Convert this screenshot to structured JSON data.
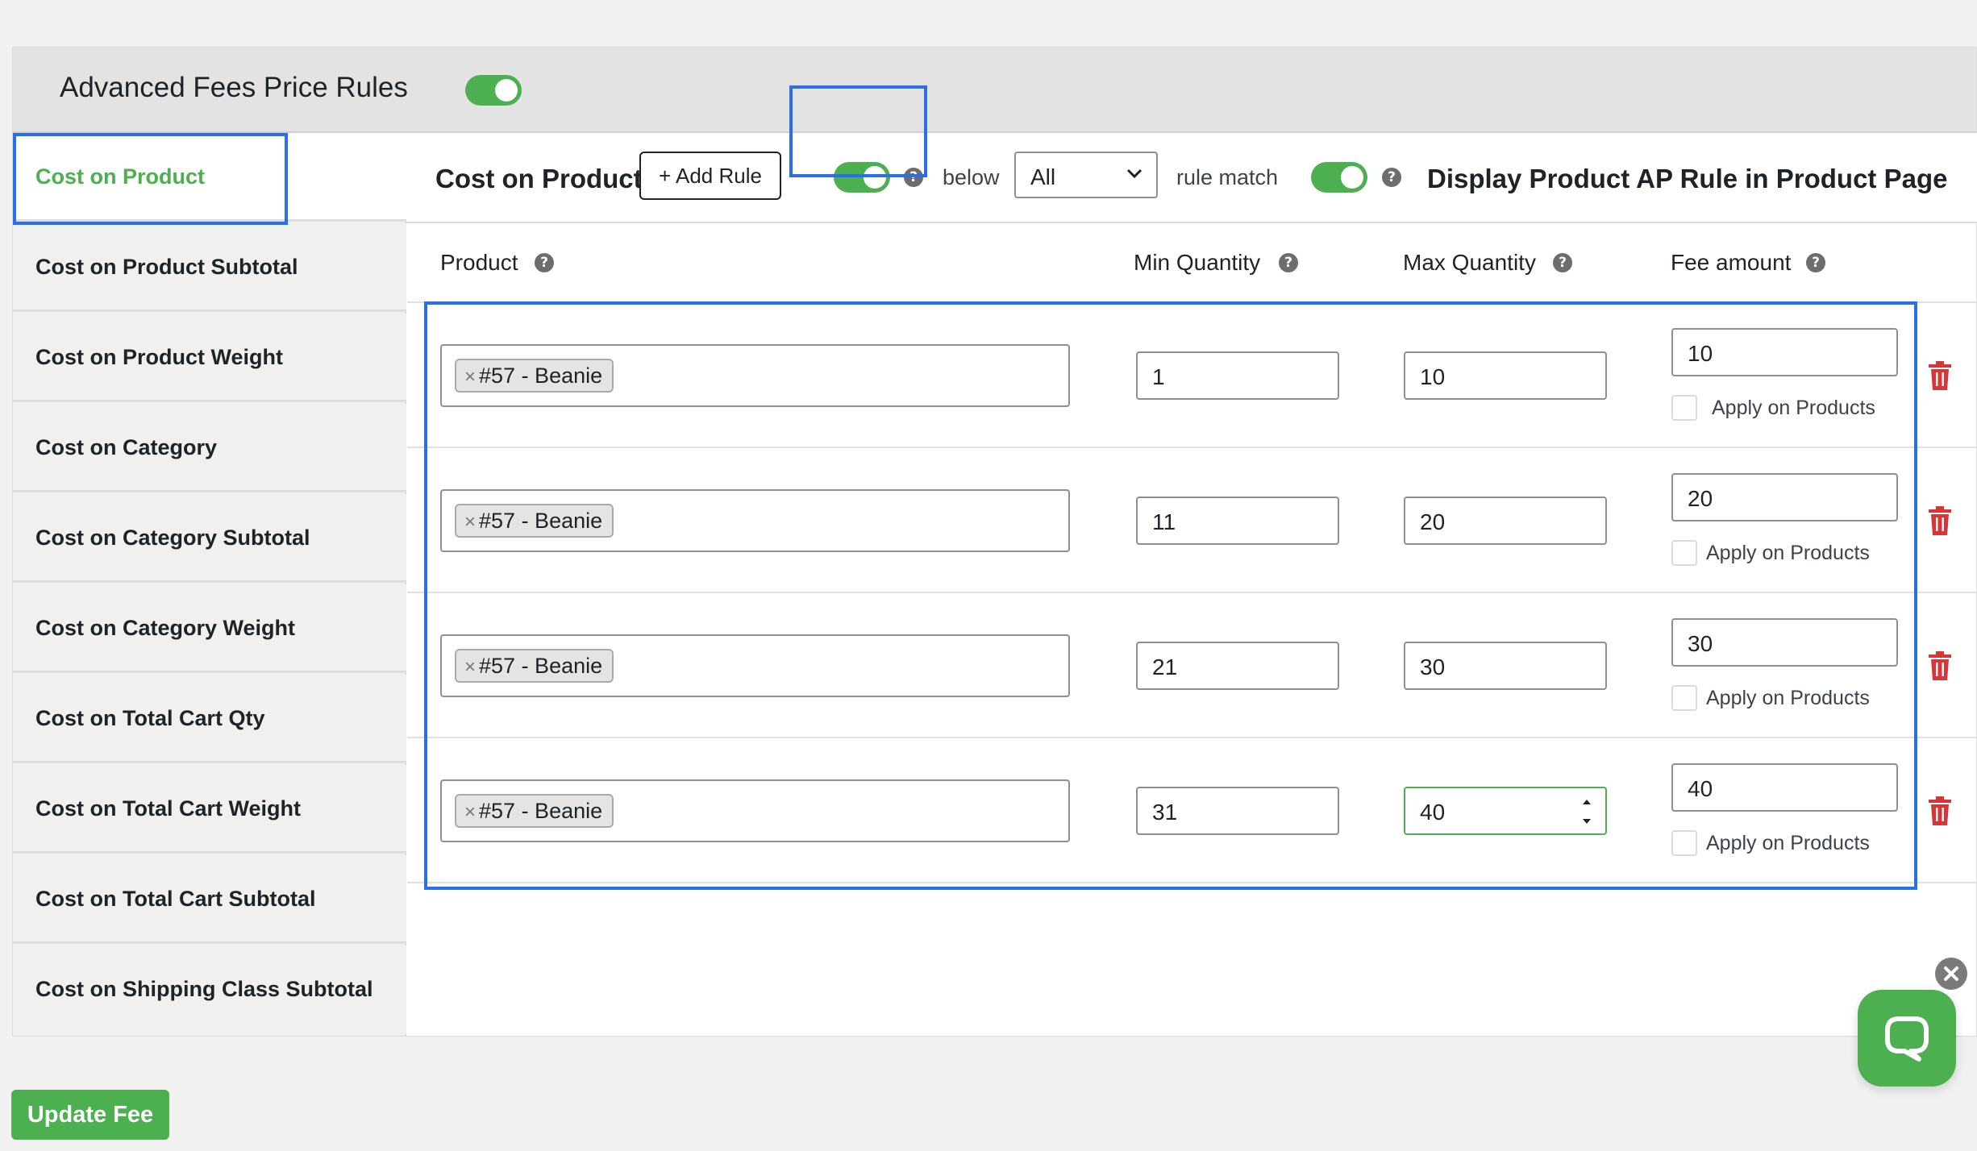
{
  "header": {
    "title": "Advanced Fees Price Rules"
  },
  "sidebar": {
    "items": [
      {
        "label": "Cost on Product",
        "active": true
      },
      {
        "label": "Cost on Product Subtotal"
      },
      {
        "label": "Cost on Product Weight"
      },
      {
        "label": "Cost on Category"
      },
      {
        "label": "Cost on Category Subtotal"
      },
      {
        "label": "Cost on Category Weight"
      },
      {
        "label": "Cost on Total Cart Qty"
      },
      {
        "label": "Cost on Total Cart Weight"
      },
      {
        "label": "Cost on Total Cart Subtotal"
      },
      {
        "label": "Cost on Shipping Class Subtotal"
      }
    ]
  },
  "toolbar": {
    "title": "Cost on Product",
    "add_rule_label": "+ Add Rule",
    "below_label": "below",
    "match_select_value": "All",
    "rule_match_label": "rule match",
    "display_label": "Display Product AP Rule in Product Page"
  },
  "columns": {
    "product": "Product",
    "min_qty": "Min Quantity",
    "max_qty": "Max Quantity",
    "fee_amount": "Fee amount"
  },
  "rules": [
    {
      "product": "#57 - Beanie",
      "min": "1",
      "max": "10",
      "fee": "10",
      "apply_label": "Apply on Products",
      "apply_checked": false
    },
    {
      "product": "#57 - Beanie",
      "min": "11",
      "max": "20",
      "fee": "20",
      "apply_label": "Apply on Products",
      "apply_checked": false
    },
    {
      "product": "#57 - Beanie",
      "min": "21",
      "max": "30",
      "fee": "30",
      "apply_label": "Apply on Products",
      "apply_checked": false
    },
    {
      "product": "#57 - Beanie",
      "min": "31",
      "max": "40",
      "fee": "40",
      "apply_label": "Apply on Products",
      "apply_checked": false
    }
  ],
  "footer": {
    "update_label": "Update Fee"
  },
  "colors": {
    "accent_green": "#4caf50",
    "highlight_blue": "#2b6fe8",
    "trash_red": "#d63638"
  },
  "icons": [
    "help-icon",
    "chevron-down-icon",
    "trash-icon",
    "close-icon",
    "chat-icon",
    "remove-tag-icon"
  ]
}
